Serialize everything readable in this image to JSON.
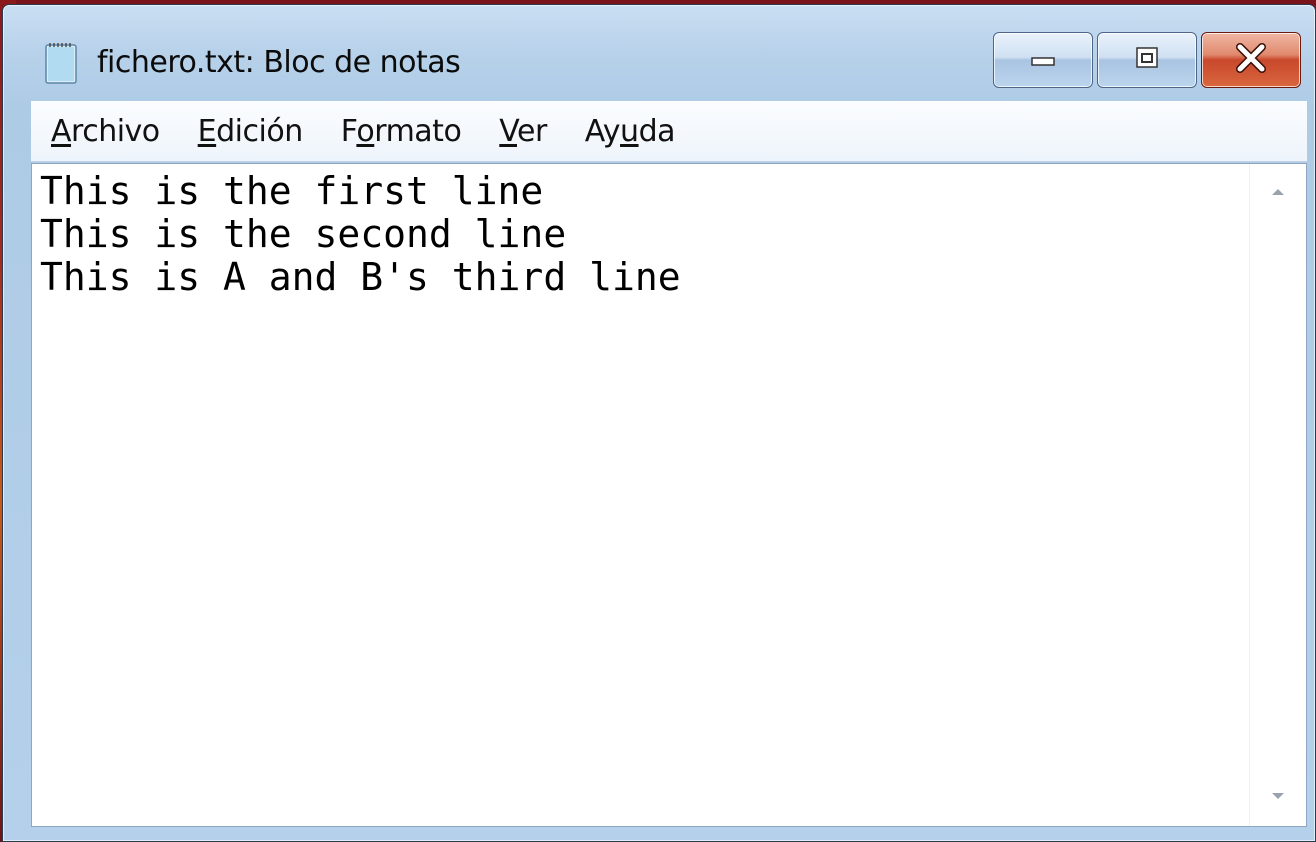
{
  "window": {
    "title": "fichero.txt: Bloc de notas",
    "icons": {
      "app": "notepad-icon",
      "minimize": "minimize-icon",
      "maximize": "maximize-icon",
      "close": "close-icon"
    }
  },
  "menubar": {
    "items": [
      {
        "pre": "",
        "accel": "A",
        "post": "rchivo"
      },
      {
        "pre": "",
        "accel": "E",
        "post": "dición"
      },
      {
        "pre": "F",
        "accel": "o",
        "post": "rmato"
      },
      {
        "pre": "",
        "accel": "V",
        "post": "er"
      },
      {
        "pre": "Ay",
        "accel": "u",
        "post": "da"
      }
    ]
  },
  "editor": {
    "lines": [
      "This is the first line",
      "This is the second line",
      "This is A and B's third line"
    ]
  },
  "scrollbar": {
    "up_icon": "scroll-up-arrow-icon",
    "down_icon": "scroll-down-arrow-icon"
  }
}
